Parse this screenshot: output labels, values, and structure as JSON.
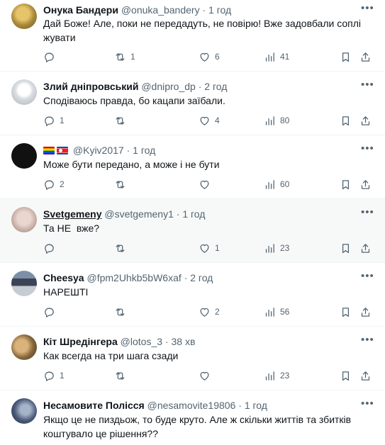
{
  "replies": [
    {
      "display_name": "Онука Бандери",
      "handle": "@onuka_bandery",
      "time": "1 год",
      "text": "Дай Боже! Але, поки не передадуть, не повірю! Вже задовбали соплі жувати",
      "stats": {
        "replies": "",
        "retweets": "1",
        "likes": "6",
        "views": "41"
      },
      "highlighted": false
    },
    {
      "display_name": "Злий дніпровський",
      "handle": "@dnipro_dp",
      "time": "2 год",
      "text": "Сподіваюсь правда, бо кацапи заїбали.",
      "stats": {
        "replies": "1",
        "retweets": "",
        "likes": "4",
        "views": "80"
      },
      "highlighted": false
    },
    {
      "display_name": "",
      "handle": "@Kyiv2017",
      "time": "1 год",
      "name_icons": [
        "rainbow-flag",
        "north-korea-flag"
      ],
      "text": "Може бути передано, а може і не бути",
      "stats": {
        "replies": "2",
        "retweets": "",
        "likes": "",
        "views": "60"
      },
      "highlighted": false
    },
    {
      "display_name": "Svetgemeny",
      "handle": "@svetgemeny1",
      "time": "1 год",
      "text": "Та НЕ  вже?",
      "stats": {
        "replies": "",
        "retweets": "",
        "likes": "1",
        "views": "23"
      },
      "highlighted": true
    },
    {
      "display_name": "Cheesya",
      "handle": "@fpm2Uhkb5bW6xaf",
      "time": "2 год",
      "text": "НАРЕШТІ",
      "stats": {
        "replies": "",
        "retweets": "",
        "likes": "2",
        "views": "56"
      },
      "highlighted": false
    },
    {
      "display_name": "Кіт Шредінгера",
      "handle": "@lotos_3",
      "time": "38 хв",
      "text": "Как всегда на три шага сзади",
      "stats": {
        "replies": "1",
        "retweets": "",
        "likes": "",
        "views": "23"
      },
      "highlighted": false
    },
    {
      "display_name": "Несамовите Полісся",
      "handle": "@nesamovite19806",
      "time": "1 год",
      "text": "Якщо це не пиздьож, то буде круто. Але ж скільки життів та збитків коштувало це рішення??",
      "stats": {
        "replies": "",
        "retweets": "",
        "likes": "",
        "views": ""
      },
      "highlighted": false
    }
  ],
  "separator": "·",
  "icons": {
    "more": "more-options-icon",
    "reply": "reply-icon",
    "retweet": "retweet-icon",
    "like": "heart-icon",
    "views": "views-chart-icon",
    "bookmark": "bookmark-icon",
    "share": "share-icon"
  },
  "colors": {
    "text": "#0f1419",
    "muted": "#536471",
    "divider": "#eff3f4",
    "highlight": "#f7f9f9"
  }
}
